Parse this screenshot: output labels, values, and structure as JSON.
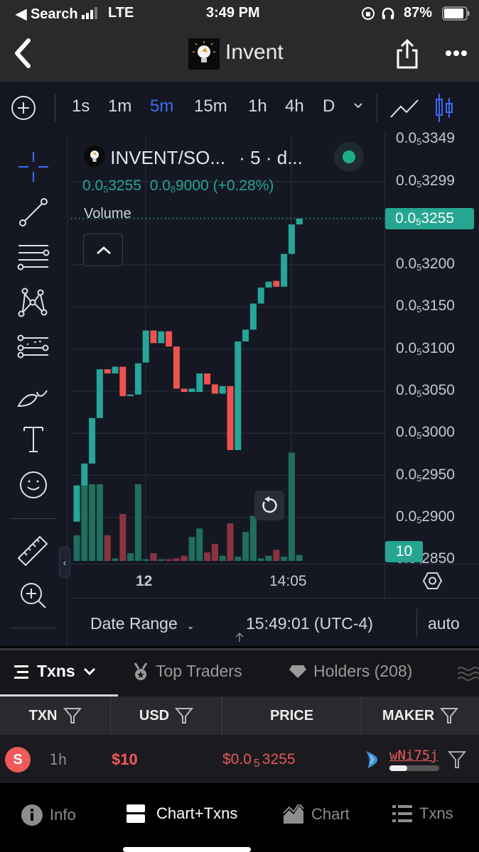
{
  "status_bar": {
    "back_app": "◀ Search",
    "carrier": "LTE",
    "time": "3:49 PM",
    "battery": "87%"
  },
  "nav": {
    "title": "Invent"
  },
  "toolbar": {
    "timeframes": [
      "1s",
      "1m",
      "5m",
      "15m",
      "1h",
      "4h",
      "D"
    ],
    "active_timeframe": "5m"
  },
  "legend": {
    "symbol": "INVENT/SO...",
    "interval": "· 5 · d...",
    "price_prefix": "0.0",
    "price_sub": "5",
    "price_rest": "3255",
    "change_prefix": "0.0",
    "change_sub": "8",
    "change_rest": "9000",
    "change_pct": "(+0.28%)",
    "volume_label": "Volume"
  },
  "price_axis": {
    "labels": [
      {
        "value": 3349,
        "text": "3349"
      },
      {
        "value": 3299,
        "text": "3299"
      },
      {
        "value": 3200,
        "text": "3200"
      },
      {
        "value": 3150,
        "text": "3150"
      },
      {
        "value": 3100,
        "text": "3100"
      },
      {
        "value": 3050,
        "text": "3050"
      },
      {
        "value": 3000,
        "text": "3000"
      },
      {
        "value": 2950,
        "text": "2950"
      },
      {
        "value": 2900,
        "text": "2900"
      },
      {
        "value": 2850,
        "text": "2850"
      }
    ],
    "prefix": "0.0",
    "sub": "5",
    "current_price": {
      "value": 3255,
      "text": "3255"
    },
    "volume_badge": "10"
  },
  "time_axis": {
    "labels": [
      {
        "text": "12",
        "bold": true
      },
      {
        "text": "14:05",
        "bold": false
      }
    ]
  },
  "chart_bottom": {
    "date_range": "Date Range",
    "clock": "15:49:01 (UTC-4)",
    "scale_mode": "auto"
  },
  "colors": {
    "up": "#26a69a",
    "down": "#ef5350",
    "accent": "#3d6af2",
    "sell": "#f05a5a"
  },
  "chart_data": {
    "type": "candlestick",
    "title": "INVENT/SOL · 5m",
    "price_unit": "0.0₅xxxx (mantissa shown)",
    "ylim": [
      2845,
      3352
    ],
    "x_ticks": [
      "12",
      "14:05"
    ],
    "candles": [
      {
        "o": 2895,
        "c": 2938,
        "v": 3
      },
      {
        "o": 2938,
        "c": 2964,
        "v": 9
      },
      {
        "o": 2964,
        "c": 3018,
        "v": 9
      },
      {
        "o": 3018,
        "c": 3076,
        "v": 9
      },
      {
        "o": 3076,
        "c": 3071,
        "v": 3
      },
      {
        "o": 3071,
        "c": 3079,
        "v": 0.3
      },
      {
        "o": 3079,
        "c": 3044,
        "v": 5.5
      },
      {
        "o": 3044,
        "c": 3046,
        "v": 0.9
      },
      {
        "o": 3046,
        "c": 3083,
        "v": 9
      },
      {
        "o": 3084,
        "c": 3122,
        "v": 0.2
      },
      {
        "o": 3122,
        "c": 3107,
        "v": 0.9
      },
      {
        "o": 3107,
        "c": 3121,
        "v": 0.2
      },
      {
        "o": 3121,
        "c": 3103,
        "v": 0.2
      },
      {
        "o": 3103,
        "c": 3053,
        "v": 0.3
      },
      {
        "o": 3053,
        "c": 3049,
        "v": 0.6
      },
      {
        "o": 3049,
        "c": 3053,
        "v": 2.8
      },
      {
        "o": 3049,
        "c": 3071,
        "v": 3.8
      },
      {
        "o": 3071,
        "c": 3058,
        "v": 1
      },
      {
        "o": 3058,
        "c": 3047,
        "v": 2
      },
      {
        "o": 3047,
        "c": 3056,
        "v": 0.6
      },
      {
        "o": 3056,
        "c": 2980,
        "v": 4.4
      },
      {
        "o": 2980,
        "c": 3109,
        "v": 0.5
      },
      {
        "o": 3109,
        "c": 3123,
        "v": 3.4
      },
      {
        "o": 3123,
        "c": 3154,
        "v": 5.3
      },
      {
        "o": 3154,
        "c": 3173,
        "v": 0.3
      },
      {
        "o": 3173,
        "c": 3180,
        "v": 0.6
      },
      {
        "o": 3181,
        "c": 3174,
        "v": 1.3
      },
      {
        "o": 3174,
        "c": 3213,
        "v": 0.5
      },
      {
        "o": 3213,
        "c": 3248,
        "v": 12.7
      },
      {
        "o": 3248,
        "c": 3255,
        "v": 0.7
      }
    ]
  },
  "txn_tabs": [
    {
      "label": "Txns",
      "active": true
    },
    {
      "label": "Top Traders",
      "active": false
    },
    {
      "label": "Holders (208)",
      "active": false
    }
  ],
  "txn_table": {
    "headers": [
      "TXN",
      "USD",
      "PRICE",
      "MAKER"
    ],
    "rows": [
      {
        "type_badge": "S",
        "age": "1h",
        "usd": "$10",
        "price_prefix": "$0.0",
        "price_sub": "5",
        "price_rest": "3255",
        "maker": "wNi75j",
        "maker_holding_fraction": 0.35
      }
    ]
  },
  "bottom_nav": [
    {
      "label": "Info",
      "active": false
    },
    {
      "label": "Chart+Txns",
      "active": true
    },
    {
      "label": "Chart",
      "active": false
    },
    {
      "label": "Txns",
      "active": false
    }
  ]
}
